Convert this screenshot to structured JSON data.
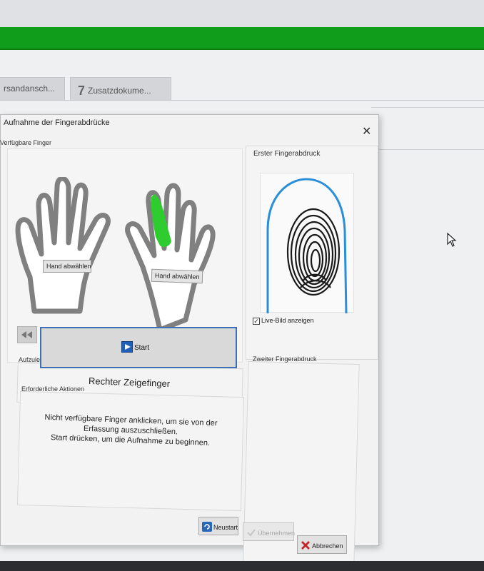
{
  "app": {
    "tabs": [
      {
        "label": "rsandansch..."
      },
      {
        "number": "7",
        "label": "Zusatzdokume..."
      }
    ]
  },
  "dialog": {
    "title": "Aufnahme der Fingerabdrücke",
    "close_glyph": "✕",
    "available_fingers_label": "Verfügbare Finger",
    "hand_left_button": "Hand abwählen",
    "hand_right_button": "Hand abwählen",
    "selected_finger_color": "#2ecc2e",
    "start_label": "Start",
    "finger_to_place_label": "Aufzulegender Finger",
    "finger_name": "Rechter Zeigefinger",
    "required_actions_label": "Erforderliche Aktionen",
    "instructions": [
      "Nicht verfügbare Finger anklicken, um sie von der",
      "Erfassung auszuschließen.",
      "Start drücken, um die Aufnahme zu beginnen."
    ],
    "first_print_label": "Erster Fingerabdruck",
    "live_image_label": "Live-Bild anzeigen",
    "live_image_checked": true,
    "second_print_label": "Zweiter Fingerabdruck",
    "buttons": {
      "restart": "Neustart",
      "accept": "Übernehmen",
      "cancel": "Abbrechen"
    }
  },
  "colors": {
    "green_bar": "#119d1c",
    "start_border": "#3b6fb6",
    "scan_outline": "#2a8fd8"
  }
}
